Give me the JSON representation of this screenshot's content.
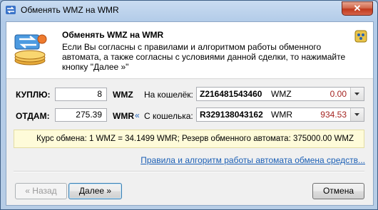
{
  "window": {
    "title": "Обменять WMZ на  WMR",
    "close_label": "✕"
  },
  "header": {
    "title": "Обменять WMZ на  WMR",
    "description": "Если Вы согласны с правилами и алгоритмом работы обменного автомата, а также согласны с условиями данной сделки, то нажимайте кнопку \"Далее »\""
  },
  "buy": {
    "label": "КУПЛЮ:",
    "amount": "8",
    "currency": "WMZ",
    "wallet_label": "На кошелёк:",
    "wallet_number": "Z216481543460",
    "wallet_currency": "WMZ",
    "wallet_balance": "0.00"
  },
  "pay": {
    "label": "ОТДАМ:",
    "amount": "275.39",
    "currency": "WMR",
    "swap_glyph": "«",
    "wallet_label": "С кошелька:",
    "wallet_number": "R329138043162",
    "wallet_currency": "WMR",
    "wallet_balance": "934.53"
  },
  "rate_text": "Курс обмена: 1 WMZ = 34.1499 WMR; Резерв обменного автомата: 375000.00 WMZ",
  "rules_link": "Правила и алгоритм работы автомата обмена средств...",
  "buttons": {
    "back": "« Назад",
    "next": "Далее »",
    "cancel": "Отмена"
  },
  "colors": {
    "balance": "#a52421",
    "link": "#1b5fb5",
    "rate_background": "#fefbd9"
  }
}
